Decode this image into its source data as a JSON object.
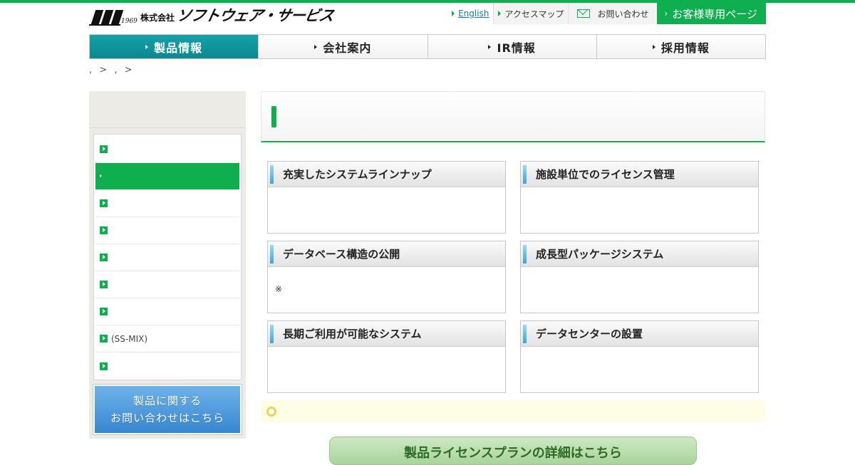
{
  "header": {
    "logo": {
      "year": "1969",
      "kabushiki": "株式会社",
      "name": "ソフトウェア・サービス"
    },
    "links": {
      "english": "English",
      "access": "アクセスマップ",
      "contact": "お問い合わせ",
      "customer": "お客様専用ページ"
    }
  },
  "nav": [
    "製品情報",
    "会社案内",
    "IR情報",
    "採用情報"
  ],
  "breadcrumb": {
    "sep1": ">",
    "sep2": ">"
  },
  "sidebar": {
    "items": [
      "",
      "",
      "",
      "",
      "",
      "",
      "",
      "(SS-MIX)",
      ""
    ],
    "contact_line1": "製品に関する",
    "contact_line2": "お問い合わせはこちら"
  },
  "features": [
    {
      "title": "充実したシステムラインナップ",
      "body": ""
    },
    {
      "title": "施設単位でのライセンス管理",
      "body": ""
    },
    {
      "title": "データベース構造の公開",
      "body": "※"
    },
    {
      "title": "成長型パッケージシステム",
      "body": ""
    },
    {
      "title": "長期ご利用が可能なシステム",
      "body": ""
    },
    {
      "title": "データセンターの設置",
      "body": ""
    }
  ],
  "bottom_button": "製品ライセンスプランの詳細はこちら",
  "colors": {
    "brand_green": "#0fae4f",
    "nav_active": "#0c8890",
    "info_blue": "#3786d0"
  }
}
